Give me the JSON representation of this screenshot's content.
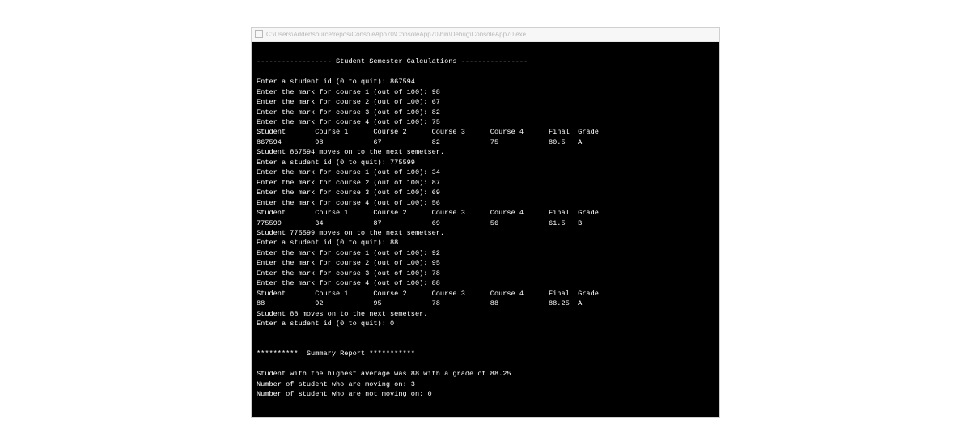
{
  "window": {
    "title_path": "C:\\Users\\Adder\\source\\repos\\ConsoleApp70\\ConsoleApp70\\bin\\Debug\\ConsoleApp70.exe"
  },
  "lines": {
    "header": "------------------ Student Semester Calculations ----------------",
    "blank": "",
    "prompt_id_1": "Enter a student id (0 to quit): 867594",
    "s1_c1": "Enter the mark for course 1 (out of 100): 98",
    "s1_c2": "Enter the mark for course 2 (out of 100): 67",
    "s1_c3": "Enter the mark for course 3 (out of 100): 82",
    "s1_c4": "Enter the mark for course 4 (out of 100): 75",
    "s1_head": "Student       Course 1      Course 2      Course 3      Course 4      Final  Grade",
    "s1_row": "867594        98            67            82            75            80.5   A",
    "s1_move": "Student 867594 moves on to the next semetser.",
    "prompt_id_2": "Enter a student id (0 to quit): 775599",
    "s2_c1": "Enter the mark for course 1 (out of 100): 34",
    "s2_c2": "Enter the mark for course 2 (out of 100): 87",
    "s2_c3": "Enter the mark for course 3 (out of 100): 69",
    "s2_c4": "Enter the mark for course 4 (out of 100): 56",
    "s2_head": "Student       Course 1      Course 2      Course 3      Course 4      Final  Grade",
    "s2_row": "775599        34            87            69            56            61.5   B",
    "s2_move": "Student 775599 moves on to the next semetser.",
    "prompt_id_3": "Enter a student id (0 to quit): 88",
    "s3_c1": "Enter the mark for course 1 (out of 100): 92",
    "s3_c2": "Enter the mark for course 2 (out of 100): 95",
    "s3_c3": "Enter the mark for course 3 (out of 100): 78",
    "s3_c4": "Enter the mark for course 4 (out of 100): 88",
    "s3_head": "Student       Course 1      Course 2      Course 3      Course 4      Final  Grade",
    "s3_row": "88            92            95            78            88            88.25  A",
    "s3_move": "Student 88 moves on to the next semetser.",
    "prompt_id_4": "Enter a student id (0 to quit): 0",
    "summary_head": "**********  Summary Report ***********",
    "summary_1": "Student with the highest average was 88 with a grade of 88.25",
    "summary_2": "Number of student who are moving on: 3",
    "summary_3": "Number of student who are not moving on: 0"
  }
}
